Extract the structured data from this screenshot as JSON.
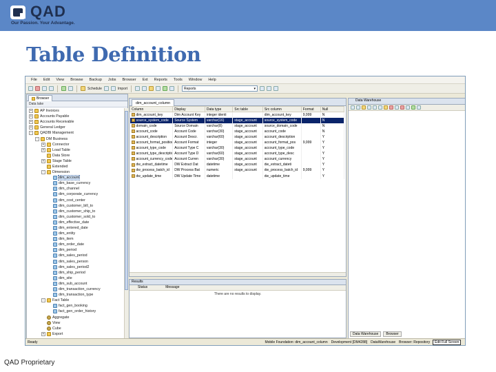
{
  "brand": {
    "logo_word": "QAD",
    "tagline": "Our Passion. Your Advantage."
  },
  "slide": {
    "title": "Table Definition",
    "footer": "QAD Proprietary"
  },
  "app": {
    "menu": [
      "File",
      "Edit",
      "View",
      "Browse",
      "Backup",
      "Jobs",
      "Browser",
      "Ext",
      "Reports",
      "Tools",
      "Window",
      "Help"
    ],
    "toolbar": {
      "scheduler": "Schedule",
      "import": "Import",
      "reports_combo": "Reports"
    },
    "tree": {
      "tab": "Browser",
      "subheader": "Data lake",
      "nodes": [
        {
          "label": "AP Invoices",
          "level": 0,
          "exp": "+",
          "icon": "folder"
        },
        {
          "label": "Accounts Payable",
          "level": 0,
          "exp": "+",
          "icon": "folder"
        },
        {
          "label": "Accounts Receivable",
          "level": 0,
          "exp": "+",
          "icon": "folder"
        },
        {
          "label": "General Ledger",
          "level": 0,
          "exp": "+",
          "icon": "folder"
        },
        {
          "label": "QADBI Management",
          "level": 0,
          "exp": "-",
          "icon": "folder"
        },
        {
          "label": "DM Business",
          "level": 1,
          "exp": "-",
          "icon": "folder"
        },
        {
          "label": "Connector",
          "level": 2,
          "exp": "+",
          "icon": "folder"
        },
        {
          "label": "Load Table",
          "level": 2,
          "exp": "+",
          "icon": "folder"
        },
        {
          "label": "Data Store",
          "level": 2,
          "exp": "",
          "icon": "folder"
        },
        {
          "label": "Stage Table",
          "level": 2,
          "exp": "+",
          "icon": "folder"
        },
        {
          "label": "Extended",
          "level": 2,
          "exp": "",
          "icon": "folder"
        },
        {
          "label": "Dimension",
          "level": 2,
          "exp": "-",
          "icon": "folder"
        },
        {
          "label": "dim_account",
          "level": 3,
          "exp": "",
          "icon": "table",
          "selected": true
        },
        {
          "label": "dim_base_currency",
          "level": 3,
          "exp": "",
          "icon": "table"
        },
        {
          "label": "dim_channel",
          "level": 3,
          "exp": "",
          "icon": "table"
        },
        {
          "label": "dim_corporate_currency",
          "level": 3,
          "exp": "",
          "icon": "table"
        },
        {
          "label": "dim_cost_center",
          "level": 3,
          "exp": "",
          "icon": "table"
        },
        {
          "label": "dim_customer_bill_to",
          "level": 3,
          "exp": "",
          "icon": "table"
        },
        {
          "label": "dim_customer_ship_to",
          "level": 3,
          "exp": "",
          "icon": "table"
        },
        {
          "label": "dim_customer_sold_to",
          "level": 3,
          "exp": "",
          "icon": "table"
        },
        {
          "label": "dim_effective_date",
          "level": 3,
          "exp": "",
          "icon": "table"
        },
        {
          "label": "dim_entered_date",
          "level": 3,
          "exp": "",
          "icon": "table"
        },
        {
          "label": "dim_entity",
          "level": 3,
          "exp": "",
          "icon": "table"
        },
        {
          "label": "dim_item",
          "level": 3,
          "exp": "",
          "icon": "table"
        },
        {
          "label": "dim_order_date",
          "level": 3,
          "exp": "",
          "icon": "table"
        },
        {
          "label": "dim_period",
          "level": 3,
          "exp": "",
          "icon": "table"
        },
        {
          "label": "dim_sales_period",
          "level": 3,
          "exp": "",
          "icon": "table"
        },
        {
          "label": "dim_sales_person",
          "level": 3,
          "exp": "",
          "icon": "table"
        },
        {
          "label": "dim_sales_period2",
          "level": 3,
          "exp": "",
          "icon": "table"
        },
        {
          "label": "dim_ship_period",
          "level": 3,
          "exp": "",
          "icon": "table"
        },
        {
          "label": "dim_site",
          "level": 3,
          "exp": "",
          "icon": "table"
        },
        {
          "label": "dim_sub_account",
          "level": 3,
          "exp": "",
          "icon": "table"
        },
        {
          "label": "dim_transaction_currency",
          "level": 3,
          "exp": "",
          "icon": "table"
        },
        {
          "label": "dim_transaction_type",
          "level": 3,
          "exp": "",
          "icon": "table"
        },
        {
          "label": "Fact Table",
          "level": 2,
          "exp": "-",
          "icon": "folder"
        },
        {
          "label": "fact_gen_booking",
          "level": 3,
          "exp": "",
          "icon": "table"
        },
        {
          "label": "fact_gen_order_history",
          "level": 3,
          "exp": "",
          "icon": "table"
        },
        {
          "label": "Aggregate",
          "level": 2,
          "exp": "",
          "icon": "gear"
        },
        {
          "label": "View",
          "level": 2,
          "exp": "",
          "icon": "gear"
        },
        {
          "label": "Cube",
          "level": 2,
          "exp": "",
          "icon": "gear"
        },
        {
          "label": "Export",
          "level": 2,
          "exp": "+",
          "icon": "folder"
        }
      ]
    },
    "editor": {
      "tab": "dim_account_column",
      "columns": [
        "Column",
        "Display",
        "Data type",
        "Src table",
        "Src column",
        "Format",
        "Null"
      ],
      "rows": [
        [
          "dim_account_key",
          "Dim Account Key",
          "integer identi",
          "",
          "dim_account_key",
          "9,999",
          "N"
        ],
        [
          "source_system_code",
          "Source System",
          "varchar(16)",
          "stage_account",
          "source_system_code",
          "",
          "N"
        ],
        [
          "domain_code",
          "Source Domain",
          "varchar(8)",
          "stage_account",
          "source_domain_code",
          "",
          "N"
        ],
        [
          "account_code",
          "Account Code",
          "varchar(30)",
          "stage_account",
          "account_code",
          "",
          "N"
        ],
        [
          "account_description",
          "Account Descr.",
          "varchar(60)",
          "stage_account",
          "account_description",
          "",
          "Y"
        ],
        [
          "account_format_position",
          "Account Format",
          "integer",
          "stage_account",
          "account_format_pos",
          "9,999",
          "Y"
        ],
        [
          "account_type_code",
          "Account Type C",
          "varchar(30)",
          "stage_account",
          "account_type_code",
          "",
          "Y"
        ],
        [
          "account_type_description",
          "Account Type D",
          "varchar(60)",
          "stage_account",
          "account_type_desc",
          "",
          "Y"
        ],
        [
          "account_currency_code",
          "Account Curren",
          "varchar(30)",
          "stage_account",
          "account_currency",
          "",
          "Y"
        ],
        [
          "dw_extract_datetime",
          "DW Extract Dat",
          "datetime",
          "stage_account",
          "dw_extract_dateti",
          "",
          "Y"
        ],
        [
          "dw_process_batch_id",
          "DW Process Bat",
          "numeric",
          "stage_account",
          "dw_process_batch_id",
          "9,999",
          "Y"
        ],
        [
          "dw_update_time",
          "DW Update Time",
          "datetime",
          "",
          "dw_update_time",
          "",
          "Y"
        ]
      ]
    },
    "results": {
      "title": "Results",
      "columns": [
        "Status",
        "Message"
      ],
      "message": "There are no results to display."
    },
    "right_dock": {
      "title": "Data Warehouse",
      "tabs": [
        "Data Warehouse",
        "Browser"
      ]
    },
    "status": {
      "left": "Ready",
      "model": "Mobile Foundation: dim_account_column",
      "connection": "Development [DM4288]",
      "user": "DataWarehouse",
      "mode": "Browser: Repository",
      "edit": "Edit Full Screen"
    }
  }
}
